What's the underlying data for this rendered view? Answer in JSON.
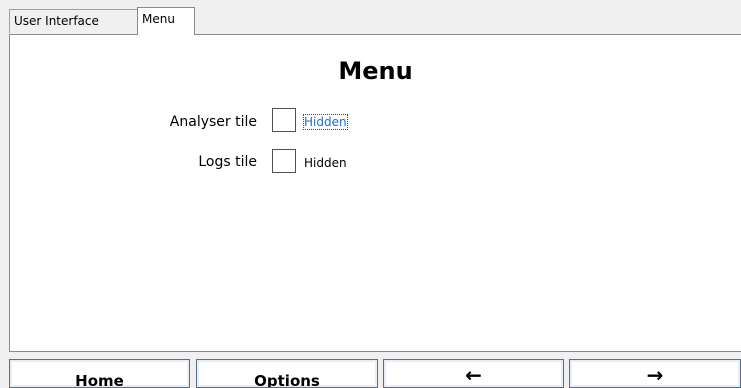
{
  "tabs": [
    {
      "label": "User Interface"
    },
    {
      "label": "Menu"
    }
  ],
  "page": {
    "title": "Menu",
    "settings": [
      {
        "label": "Analyser tile",
        "value": "Hidden",
        "checked": false
      },
      {
        "label": "Logs tile",
        "value": "Hidden",
        "checked": false
      }
    ]
  },
  "bottom_bar": {
    "home": "Home",
    "options": "Options",
    "back": "←",
    "forward": "→"
  },
  "colors": {
    "link": "#1a6fd0",
    "button_border": "#5a6e8c"
  }
}
